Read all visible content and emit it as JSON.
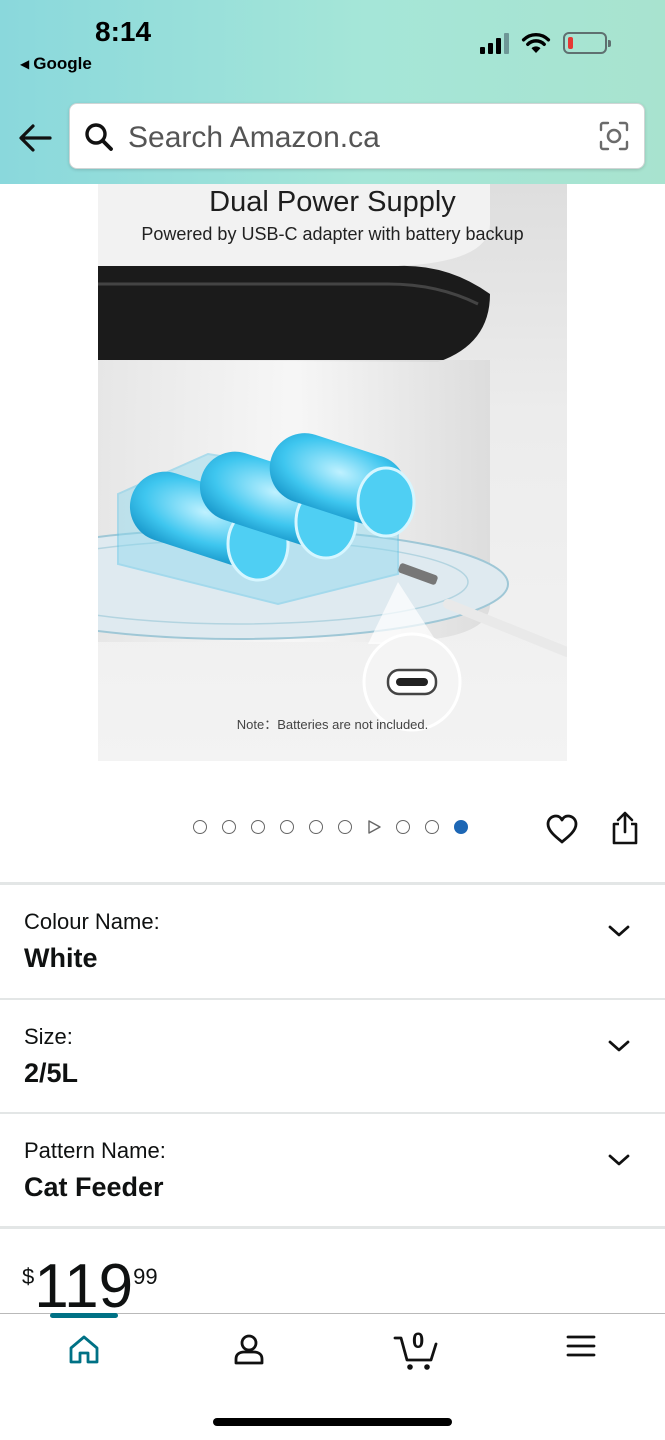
{
  "status_bar": {
    "time": "8:14",
    "back_app": "Google",
    "back_app_icon": "triangle-left-icon",
    "battery_color": "#e53935"
  },
  "search": {
    "placeholder": "Search Amazon.ca",
    "back_icon": "arrow-left-icon",
    "search_icon": "magnifier-icon",
    "camera_icon": "camera-lens-icon"
  },
  "product_image": {
    "title": "Dual Power Supply",
    "subtitle": "Powered by USB-C adapter with battery backup",
    "note": "Note：Batteries are not included."
  },
  "carousel": {
    "total": 10,
    "active_index": 9,
    "video_index": 6,
    "active_color": "#1d67b5"
  },
  "variations": [
    {
      "label": "Colour Name:",
      "value": "White"
    },
    {
      "label": "Size:",
      "value": "2/5L"
    },
    {
      "label": "Pattern Name:",
      "value": "Cat Feeder"
    }
  ],
  "price": {
    "symbol": "$",
    "whole": "119",
    "fraction": "99"
  },
  "bottom_nav": {
    "items": [
      "home-icon",
      "account-icon",
      "cart-icon",
      "menu-icon"
    ],
    "active": "home",
    "cart_count": "0",
    "accent": "#007185"
  }
}
